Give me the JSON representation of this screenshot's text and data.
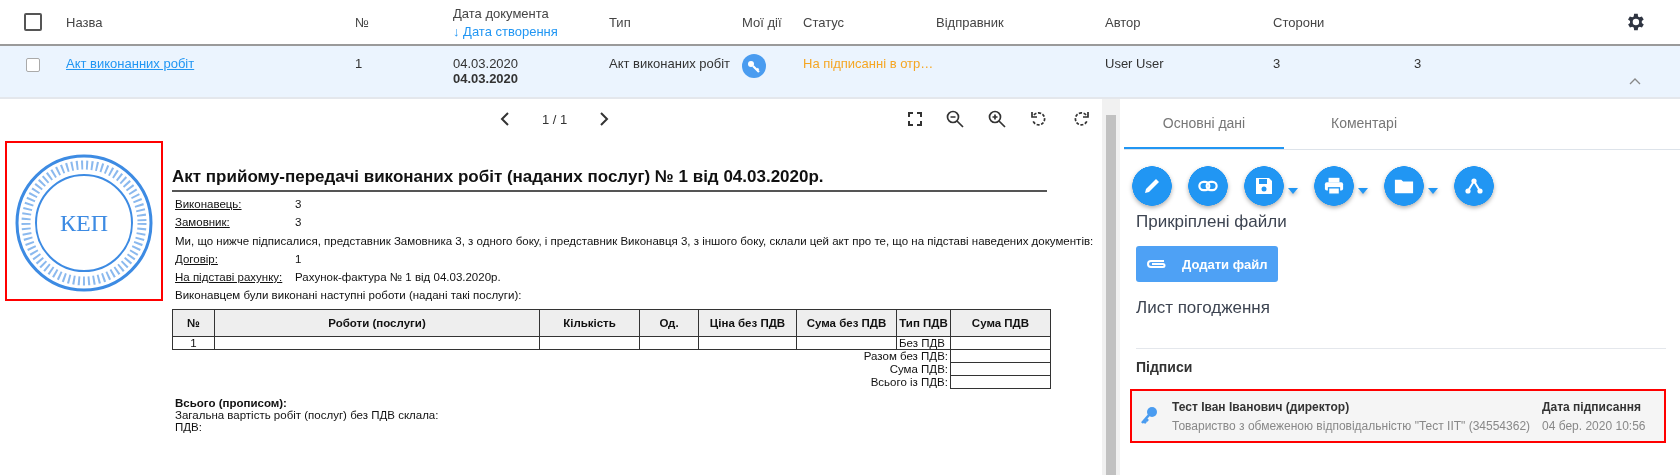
{
  "table": {
    "select_all": {
      "checked": false
    },
    "columns": [
      {
        "label": "Назва"
      },
      {
        "label": "№"
      },
      {
        "label": "Дата документа",
        "sort_label": "↓ Дата створення"
      },
      {
        "label": "Тип"
      },
      {
        "label": "Мої дії"
      },
      {
        "label": "Статус"
      },
      {
        "label": "Відправник"
      },
      {
        "label": "Автор"
      },
      {
        "label": "Сторони"
      }
    ],
    "rows": [
      {
        "checked": false,
        "selected": true,
        "expanded": true,
        "name": "Акт виконанних робіт",
        "number": "1",
        "doc_date": "04.03.2020",
        "created_date": "04.03.2020",
        "type": "Акт виконаних робіт",
        "status": "На підписанні в отр…",
        "sender": "",
        "author": "User User",
        "parties": "3",
        "column_10": "3"
      }
    ]
  },
  "viewer": {
    "page": "1 / 1",
    "stamp": {
      "label": "КЕП"
    },
    "document": {
      "title": "Акт прийому-передачі виконаних робіт (наданих послуг) № 1 від 04.03.2020р.",
      "fields": [
        {
          "label": "Виконавець:",
          "value": "3"
        },
        {
          "label": "Замовник:",
          "value": "3"
        }
      ],
      "statement": "Ми, що нижче підписалися, представник Замовника 3, з одного боку, і представник Виконавця 3, з іншого боку, склали цей акт про те, що на підставі наведених документів:",
      "basis": [
        {
          "label": "Договір:",
          "value": "1"
        },
        {
          "label": "На підставі рахунку:",
          "value": "Рахунок-фактура № 1 від 04.03.2020р."
        }
      ],
      "works_intro": "Виконавцем були виконані наступні роботи (надані такі послуги):",
      "works_table": {
        "columns": [
          "№",
          "Роботи (послуги)",
          "Кількість",
          "Од.",
          "Ціна без ПДВ",
          "Сума без ПДВ",
          "Тип ПДВ",
          "Сума ПДВ"
        ],
        "rows": [
          [
            "1",
            "",
            "",
            "",
            "",
            "",
            "Без ПДВ",
            ""
          ]
        ],
        "totals": [
          {
            "label": "Разом без ПДВ:"
          },
          {
            "label": "Сума ПДВ:"
          },
          {
            "label": "Всього із ПДВ:"
          }
        ]
      },
      "total_words_heading": "Всього (прописом):",
      "total_lines": [
        "Загальна вартість робіт (послуг) без ПДВ склала:",
        "ПДВ:"
      ]
    }
  },
  "details": {
    "tabs": [
      {
        "label": "Основні дані",
        "selected": true
      },
      {
        "label": "Коментарі",
        "selected": false
      }
    ],
    "actions": [
      {
        "kind": "edit",
        "dropdown": false
      },
      {
        "kind": "link",
        "dropdown": false
      },
      {
        "kind": "save",
        "dropdown": true
      },
      {
        "kind": "print",
        "dropdown": true
      },
      {
        "kind": "folder",
        "dropdown": true
      },
      {
        "kind": "route",
        "dropdown": false
      }
    ],
    "attached_title": "Прикріплені файли",
    "add_file": "Додати файл",
    "approval_title": "Лист погодження",
    "signatures_title": "Підписи",
    "signatures": [
      {
        "name": "Тест Іван Іванович (директор)",
        "org": "Товариство з обмеженою відповідальністю \"Тест IIT\" (34554362)",
        "date_label": "Дата підписання",
        "date": "04 бер. 2020 10:56"
      }
    ]
  }
}
